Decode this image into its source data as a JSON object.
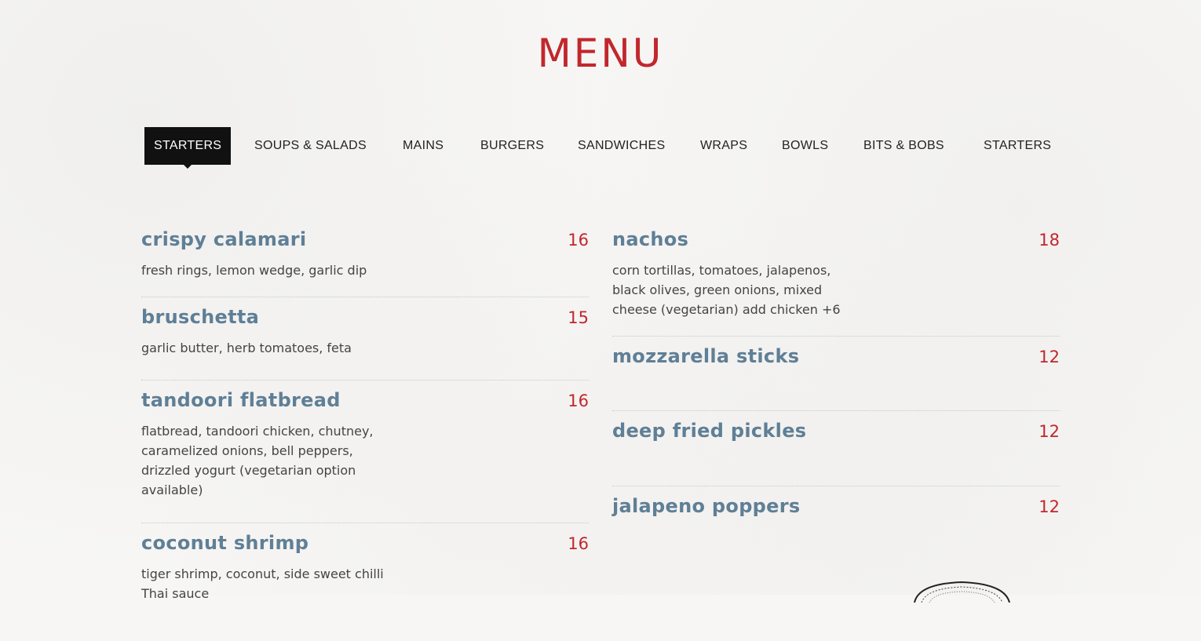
{
  "title": "MENU",
  "tabs": [
    {
      "label": "STARTERS",
      "active": true
    },
    {
      "label": "SOUPS & SALADS",
      "active": false
    },
    {
      "label": "MAINS",
      "active": false
    },
    {
      "label": "BURGERS",
      "active": false
    },
    {
      "label": "SANDWICHES",
      "active": false
    },
    {
      "label": "WRAPS",
      "active": false
    },
    {
      "label": "BOWLS",
      "active": false
    },
    {
      "label": "BITS & BOBS",
      "active": false
    },
    {
      "label": "STARTERS",
      "active": false
    }
  ],
  "left_items": [
    {
      "name": "crispy calamari",
      "price": "16",
      "desc": "fresh rings, lemon wedge, garlic dip"
    },
    {
      "name": "bruschetta",
      "price": "15",
      "desc": "garlic butter, herb tomatoes, feta"
    },
    {
      "name": "tandoori flatbread",
      "price": "16",
      "desc": "flatbread, tandoori chicken, chutney, caramelized onions, bell peppers, drizzled yogurt (vegetarian option available)"
    },
    {
      "name": "coconut shrimp",
      "price": "16",
      "desc": "tiger shrimp, coconut, side sweet chilli Thai sauce"
    }
  ],
  "right_items": [
    {
      "name": "nachos",
      "price": "18",
      "desc": "corn tortillas, tomatoes, jalapenos, black olives, green onions, mixed cheese (vegetarian) add chicken +6"
    },
    {
      "name": "mozzarella sticks",
      "price": "12",
      "desc": ""
    },
    {
      "name": "deep fried pickles",
      "price": "12",
      "desc": ""
    },
    {
      "name": "jalapeno poppers",
      "price": "12",
      "desc": ""
    }
  ],
  "colors": {
    "accent": "#c1272d",
    "item_name": "#5f7f96",
    "tab_active_bg": "#111111"
  }
}
